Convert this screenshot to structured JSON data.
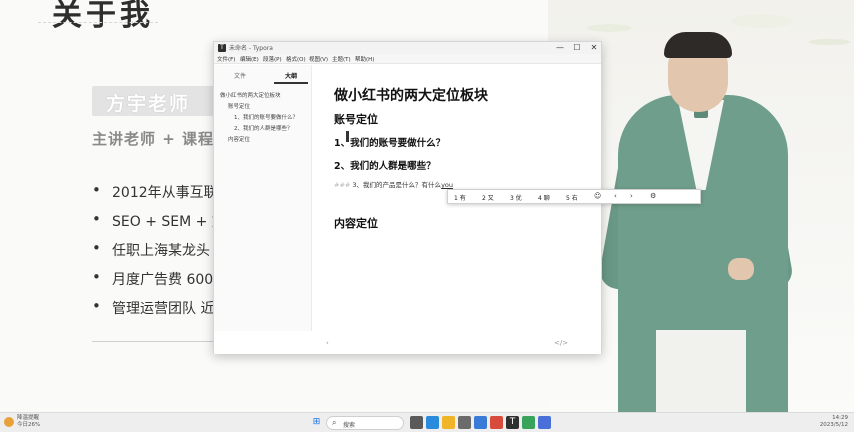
{
  "slide": {
    "title": "关于我",
    "name": "方宇老师",
    "role": "主讲老师 + 课程",
    "bullets": [
      "2012年从事互联",
      "SEO + SEM + 文",
      "任职上海某龙头",
      "月度广告费 600",
      "管理运营团队 近"
    ]
  },
  "window": {
    "title": "未命名 - Typora",
    "menu": [
      "文件(F)",
      "编辑(E)",
      "段落(P)",
      "格式(O)",
      "视图(V)",
      "主题(T)",
      "帮助(H)"
    ],
    "controls": {
      "minimize": "—",
      "maximize": "☐",
      "close": "✕"
    },
    "sidebar": {
      "tabs": [
        "文件",
        "大纲"
      ],
      "active_tab": "大纲",
      "outline": [
        "做小红书的两大定位板块",
        "账号定位",
        "1、我们的账号要做什么？",
        "2、我们的人群是哪些？",
        "内容定位"
      ]
    },
    "document": {
      "h1": "做小红书的两大定位板块",
      "h2_account": "账号定位",
      "item1": "1、我们的账号要做什么？",
      "item2": "2、我们的人群是哪些？",
      "editing_prefix": "###",
      "editing_text": "3、我们的产品是什么？有什么",
      "composing": "you",
      "h2_content": "内容定位"
    },
    "status": {
      "left_icon": "‹",
      "code_icon": "</>"
    }
  },
  "ime": {
    "candidates": [
      "1 有",
      "2 又",
      "3 优",
      "4 聊",
      "5 右"
    ],
    "controls": [
      "☺",
      "‹",
      "›",
      "⚙"
    ]
  },
  "taskbar": {
    "weather_title": "降温提醒",
    "weather_sub": "今日26%",
    "search_label": "搜索",
    "clock_time": "14:29",
    "clock_date": "2023/5/12"
  },
  "colors": {
    "suit": "#6f9e8c",
    "window_bg": "#ffffff",
    "taskbar": "#eeeeee"
  }
}
